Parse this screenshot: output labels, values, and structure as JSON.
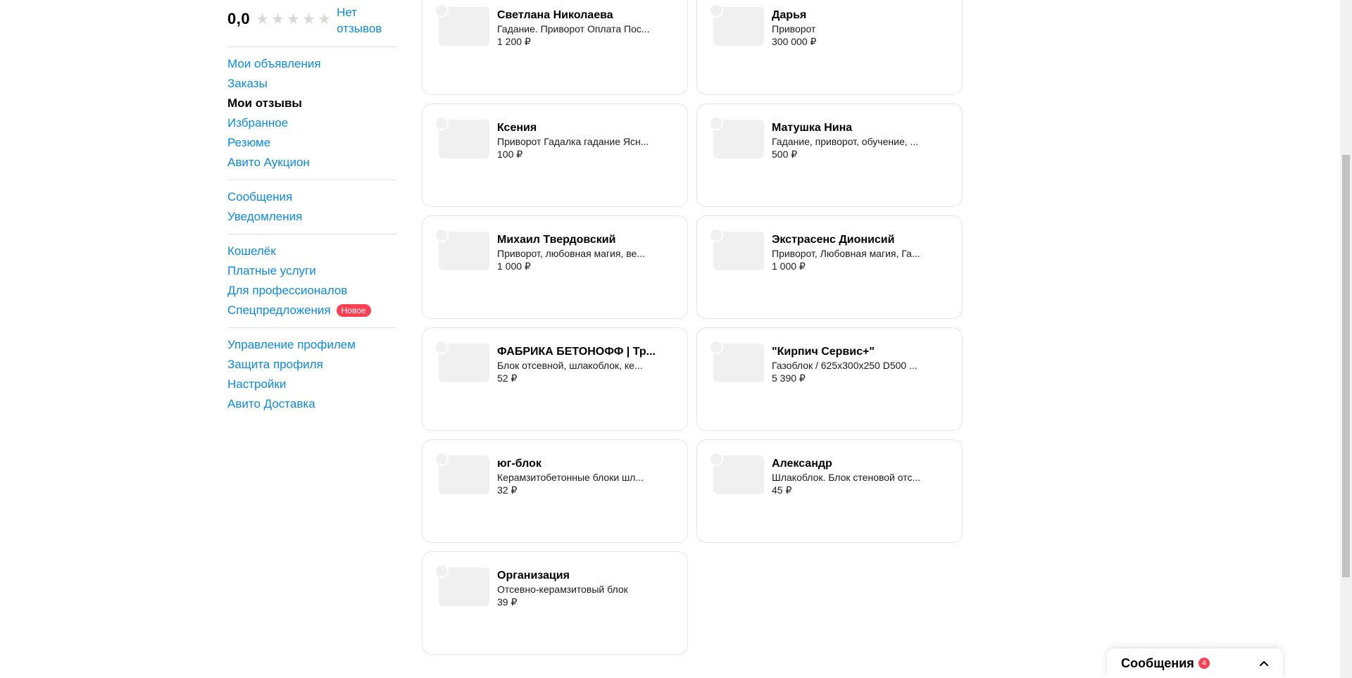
{
  "sidebar": {
    "rating": "0,0",
    "no_reviews": "Нет отзывов",
    "groups": [
      [
        {
          "label": "Мои объявления"
        },
        {
          "label": "Заказы"
        },
        {
          "label": "Мои отзывы"
        },
        {
          "label": "Избранное"
        },
        {
          "label": "Резюме"
        },
        {
          "label": "Авито Аукцион"
        }
      ],
      [
        {
          "label": "Сообщения"
        },
        {
          "label": "Уведомления"
        }
      ],
      [
        {
          "label": "Кошелёк"
        },
        {
          "label": "Платные услуги"
        },
        {
          "label": "Для профессионалов"
        },
        {
          "label": "Спецпредложения",
          "badge": "Новое"
        }
      ],
      [
        {
          "label": "Управление профилем"
        },
        {
          "label": "Защита профиля"
        },
        {
          "label": "Настройки"
        },
        {
          "label": "Авито Доставка"
        }
      ]
    ]
  },
  "cards": [
    {
      "title": "Светлана Николаева",
      "desc": "Гадание. Приворот Оплата Пос...",
      "price": "1 200 ₽"
    },
    {
      "title": "Дарья",
      "desc": "Приворот",
      "price": "300 000 ₽"
    },
    {
      "title": "Ксения",
      "desc": "Приворот Гадалка гадание Ясн...",
      "price": "100 ₽"
    },
    {
      "title": "Матушка Нина",
      "desc": "Гадание, приворот, обучение, ...",
      "price": "500 ₽"
    },
    {
      "title": "Михаил Твердовский",
      "desc": "Приворот, любовная магия, ве...",
      "price": "1 000 ₽"
    },
    {
      "title": "Экстрасенс Дионисий",
      "desc": "Приворот, Любовная магия, Га...",
      "price": "1 000 ₽"
    },
    {
      "title": "ФАБРИКА БЕТОНОФФ | Тр...",
      "desc": "Блок отсевной, шлакоблок, ке...",
      "price": "52 ₽"
    },
    {
      "title": "\"Кирпич Сервис+\"",
      "desc": "Газоблок / 625x300x250 D500 ...",
      "price": "5 390 ₽"
    },
    {
      "title": "юг-блок",
      "desc": "Керамзитобетонные блоки шл...",
      "price": "32 ₽"
    },
    {
      "title": "Александр",
      "desc": "Шлакоблок. Блок стеновой отс...",
      "price": "45 ₽"
    },
    {
      "title": "Организация",
      "desc": "Отсевно-керамзитовый блок",
      "price": "39 ₽"
    }
  ],
  "messages_widget": {
    "label": "Сообщения",
    "count": "4"
  },
  "colors": {
    "link": "#0a8ae6",
    "badge": "#ff4053"
  }
}
